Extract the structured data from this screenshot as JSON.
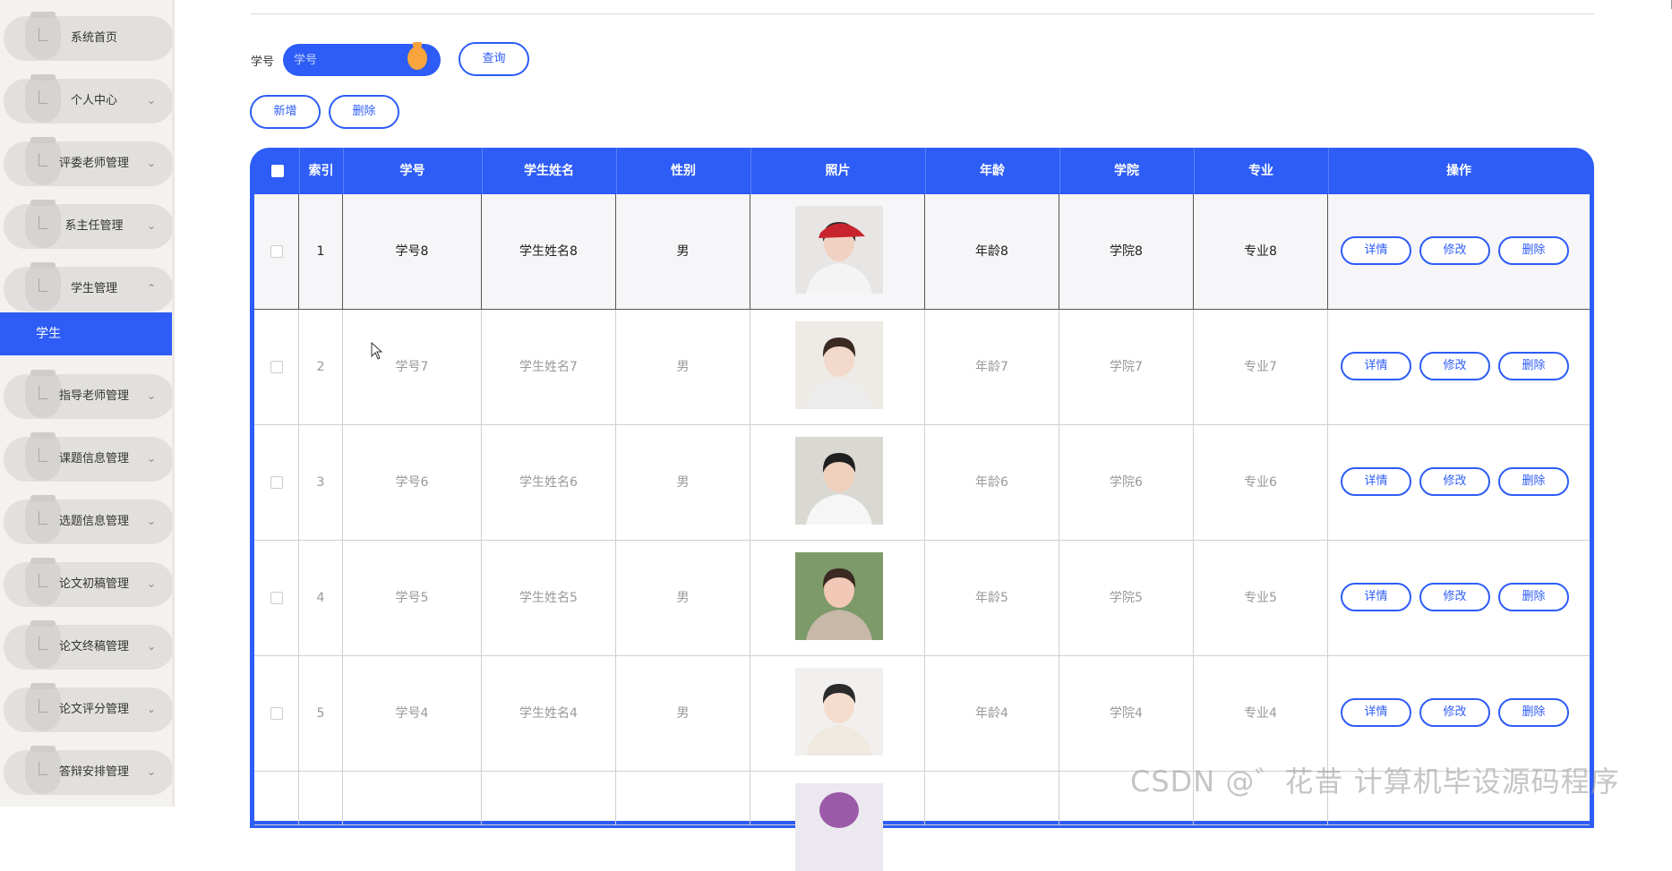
{
  "sidebar": {
    "items": [
      {
        "label": "系统首页",
        "chevron": ""
      },
      {
        "label": "个人中心",
        "chevron": "⌄"
      },
      {
        "label": "评委老师管理",
        "chevron": "⌄"
      },
      {
        "label": "系主任管理",
        "chevron": "⌄"
      },
      {
        "label": "学生管理",
        "chevron": "⌃"
      },
      {
        "label": "指导老师管理",
        "chevron": "⌄"
      },
      {
        "label": "课题信息管理",
        "chevron": "⌄"
      },
      {
        "label": "选题信息管理",
        "chevron": "⌄"
      },
      {
        "label": "论文初稿管理",
        "chevron": "⌄"
      },
      {
        "label": "论文终稿管理",
        "chevron": "⌄"
      },
      {
        "label": "论文评分管理",
        "chevron": "⌄"
      },
      {
        "label": "答辩安排管理",
        "chevron": "⌄"
      }
    ],
    "sub_item": "学生"
  },
  "search": {
    "label": "学号",
    "placeholder": "学号",
    "query_button": "查询"
  },
  "toolbar": {
    "add_button": "新增",
    "delete_button": "删除"
  },
  "table": {
    "headers": [
      "索引",
      "学号",
      "学生姓名",
      "性别",
      "照片",
      "年龄",
      "学院",
      "专业",
      "操作"
    ],
    "rows": [
      {
        "index": "1",
        "student_no": "学号8",
        "name": "学生姓名8",
        "gender": "男",
        "age": "年龄8",
        "college": "学院8",
        "major": "专业8"
      },
      {
        "index": "2",
        "student_no": "学号7",
        "name": "学生姓名7",
        "gender": "男",
        "age": "年龄7",
        "college": "学院7",
        "major": "专业7"
      },
      {
        "index": "3",
        "student_no": "学号6",
        "name": "学生姓名6",
        "gender": "男",
        "age": "年龄6",
        "college": "学院6",
        "major": "专业6"
      },
      {
        "index": "4",
        "student_no": "学号5",
        "name": "学生姓名5",
        "gender": "男",
        "age": "年龄5",
        "college": "学院5",
        "major": "专业5"
      },
      {
        "index": "5",
        "student_no": "学号4",
        "name": "学生姓名4",
        "gender": "男",
        "age": "年龄4",
        "college": "学院4",
        "major": "专业4"
      }
    ],
    "actions": {
      "detail": "详情",
      "edit": "修改",
      "delete": "删除"
    }
  },
  "watermark": "CSDN @゛花昔 计算机毕设源码程序",
  "colors": {
    "accent": "#2d5cf6",
    "sidebar_bg": "#f4f2ef"
  }
}
